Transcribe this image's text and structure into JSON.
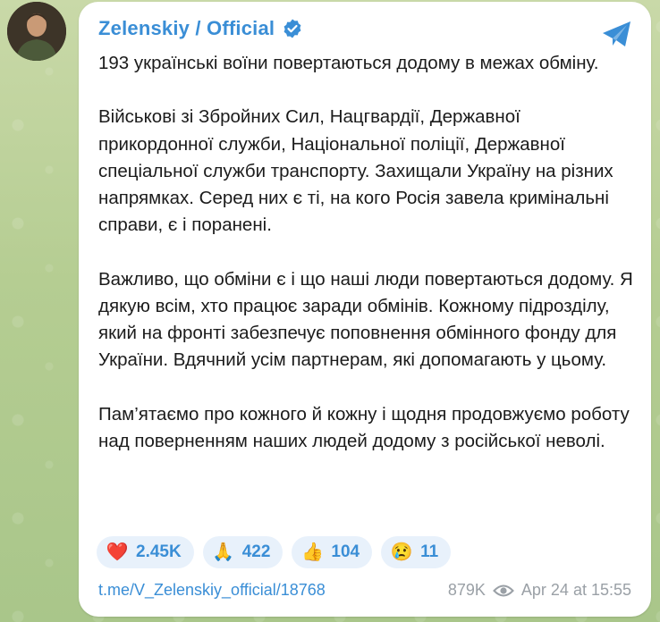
{
  "channel": {
    "name": "Zelenskiy / Official"
  },
  "message": {
    "paragraphs": [
      "193 українські воїни повертаються додому в межах обміну.",
      "Військові зі Збройних Сил, Нацгвардії, Державної прикордонної служби, Національної поліції, Державної спеціальної служби транспорту. Захищали Україну на різних напрямках. Серед них є ті, на кого Росія завела кримінальні справи, є і поранені.",
      "Важливо, що обміни є і що наші люди повертаються додому. Я дякую всім, хто працює заради обмінів. Кожному підрозділу, який на фронті забезпечує поповнення обмінного фонду для України. Вдячний усім партнерам, які допомагають у цьому.",
      "Пам’ятаємо про кожного й кожну і щодня продовжуємо роботу над поверненням наших людей додому з російської неволі."
    ]
  },
  "reactions": [
    {
      "emoji": "❤️",
      "icon": "heart-icon",
      "count": "2.45K"
    },
    {
      "emoji": "🙏",
      "icon": "folded-hands-icon",
      "count": "422"
    },
    {
      "emoji": "👍",
      "icon": "thumbs-up-icon",
      "count": "104"
    },
    {
      "emoji": "😢",
      "icon": "crying-face-icon",
      "count": "11"
    }
  ],
  "footer": {
    "link": "t.me/V_Zelenskiy_official/18768",
    "views": "879K",
    "timestamp": "Apr 24 at 15:55"
  },
  "colors": {
    "accent": "#3a8ed6",
    "reaction_bg": "#e8f1fb",
    "meta_text": "#9aa0a6",
    "background": "#b5cd92"
  }
}
